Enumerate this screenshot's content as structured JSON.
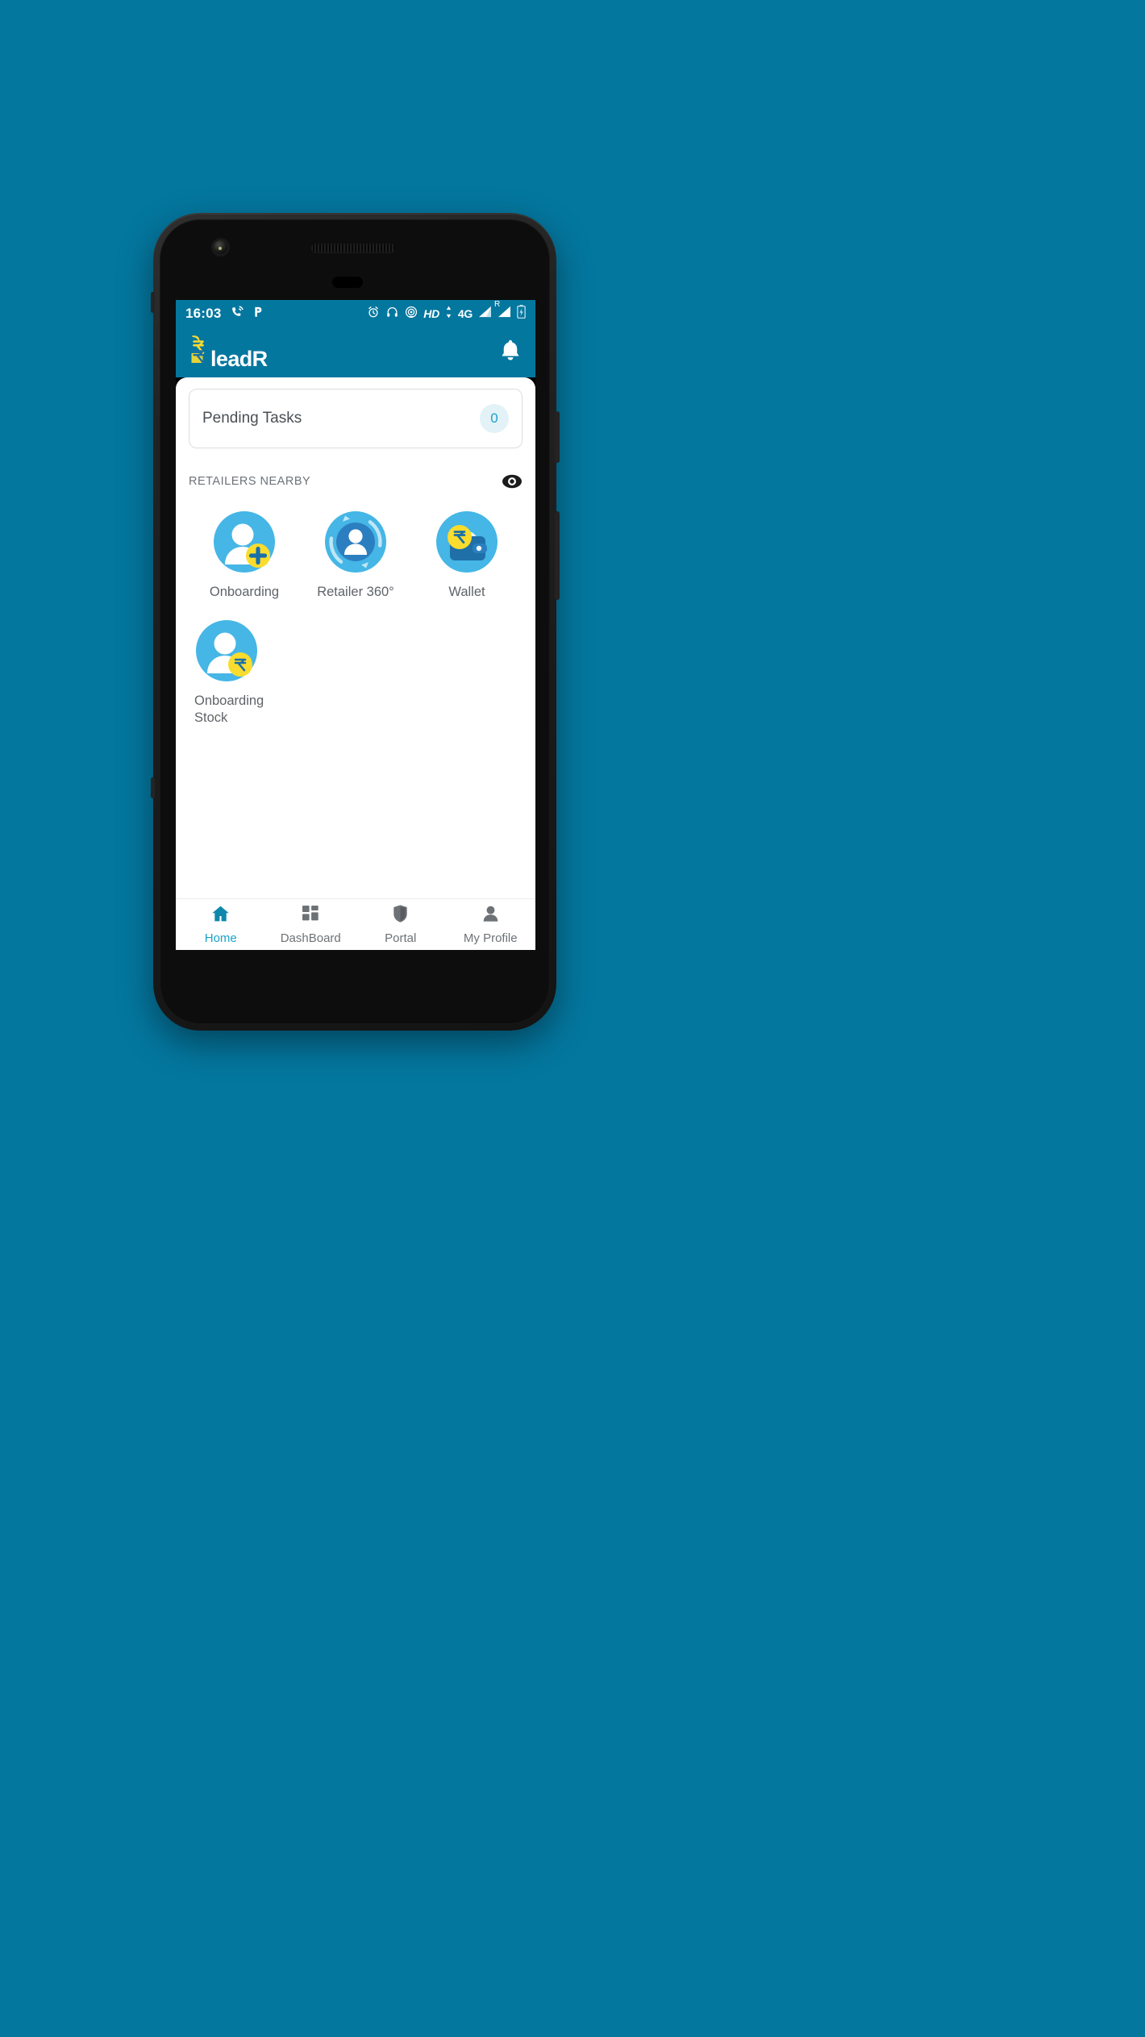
{
  "page": {
    "background_color": "#04779f",
    "brand_color": "#04779f",
    "accent_color": "#1aa3c9",
    "icon_blue": "#45b6e6",
    "icon_dark_blue": "#1a6fa8",
    "icon_yellow": "#f9dc2e"
  },
  "status_bar": {
    "clock": "16:03",
    "hd_label": "HD",
    "network_type": "4G",
    "roaming_label": "R",
    "left_icons": [
      "missed-call-icon",
      "parking-p-icon"
    ],
    "right_icons": [
      "alarm-clock-icon",
      "headphones-icon",
      "hotspot-icon",
      "hd-icon",
      "data-arrows-icon",
      "signal-bars-icon",
      "signal-bars-roaming-icon",
      "battery-charging-icon"
    ]
  },
  "app_bar": {
    "title": "leadR",
    "logo_icon": "rupee-signal-logo-icon",
    "notification_icon": "bell-icon"
  },
  "pending_tasks": {
    "label": "Pending Tasks",
    "count": "0"
  },
  "retailers_section": {
    "title": "RETAILERS NEARBY",
    "toggle_icon": "eye-icon"
  },
  "shortcuts": [
    {
      "label": "Onboarding",
      "icon": "person-add-icon"
    },
    {
      "label": "Retailer 360°",
      "icon": "person-refresh-icon"
    },
    {
      "label": "Wallet",
      "icon": "wallet-rupee-icon"
    },
    {
      "label": "Onboarding Stock",
      "icon": "person-rupee-icon"
    }
  ],
  "bottom_nav": [
    {
      "label": "Home",
      "icon": "home-icon",
      "active": true
    },
    {
      "label": "DashBoard",
      "icon": "grid-icon",
      "active": false
    },
    {
      "label": "Portal",
      "icon": "shield-icon",
      "active": false
    },
    {
      "label": "My Profile",
      "icon": "person-icon",
      "active": false
    }
  ]
}
